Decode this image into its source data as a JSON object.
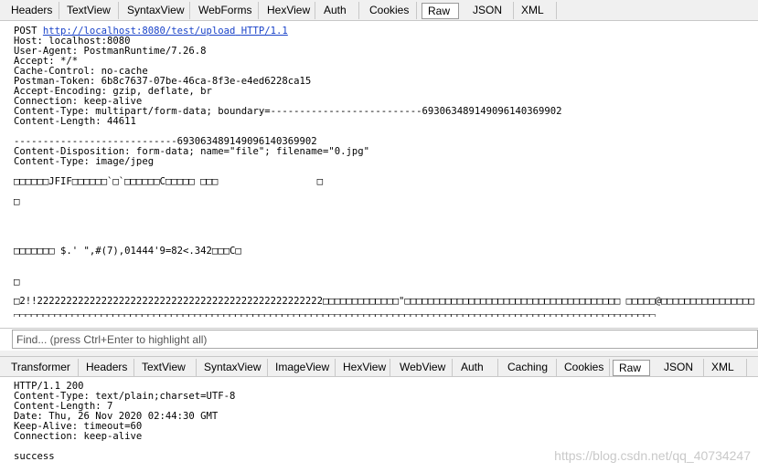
{
  "request_tabs": [
    "Headers",
    "TextView",
    "SyntaxView",
    "WebForms",
    "HexView",
    "Auth",
    "Cookies",
    "Raw",
    "JSON",
    "XML"
  ],
  "request": {
    "method": "POST",
    "url": "http://localhost:8080/test/upload",
    "protocol": "HTTP/1.1",
    "headers": [
      "Host: localhost:8080",
      "User-Agent: PostmanRuntime/7.26.8",
      "Accept: */*",
      "Cache-Control: no-cache",
      "Postman-Token: 6b8c7637-07be-46ca-8f3e-e4ed6228ca15",
      "Accept-Encoding: gzip, deflate, br",
      "Connection: keep-alive",
      "Content-Type: multipart/form-data; boundary=--------------------------693063489149096140369902",
      "Content-Length: 44611"
    ],
    "body_lines": [
      "----------------------------693063489149096140369902",
      "Content-Disposition: form-data; name=\"file\"; filename=\"0.jpg\"",
      "Content-Type: image/jpeg"
    ],
    "binary_lines": [
      "□□□□□□JFIF□□□□□□`□`□□□□□□C□□□□□ □□□                 □",
      "□",
      "□□□□□□□ $.' \",#(7),01444'9=82<.342□□□C□",
      "□",
      "□2!!2222222222222222222222222222222222222222222222222□□□□□□□□□□□□□\"□□□□□□□□□□□□□□□□□□□□□□□□□□□□□□□□□□□□□ □□□□□@□□□□□□□□□□□□□□□□"
    ]
  },
  "find_bar": {
    "placeholder": "Find... (press Ctrl+Enter to highlight all)"
  },
  "response_tabs": [
    "Transformer",
    "Headers",
    "TextView",
    "SyntaxView",
    "ImageView",
    "HexView",
    "WebView",
    "Auth",
    "Caching",
    "Cookies",
    "Raw",
    "JSON",
    "XML"
  ],
  "response": {
    "status_line": "HTTP/1.1 200",
    "headers": [
      "Content-Type: text/plain;charset=UTF-8",
      "Content-Length: 7",
      "Date: Thu, 26 Nov 2020 02:44:30 GMT",
      "Keep-Alive: timeout=60",
      "Connection: keep-alive"
    ],
    "body": "success"
  },
  "watermark": "https://blog.csdn.net/qq_40734247",
  "colors": {
    "url": "#1a43c9",
    "tab_bar": "#f0f0f0",
    "border": "#c8c8c8"
  }
}
